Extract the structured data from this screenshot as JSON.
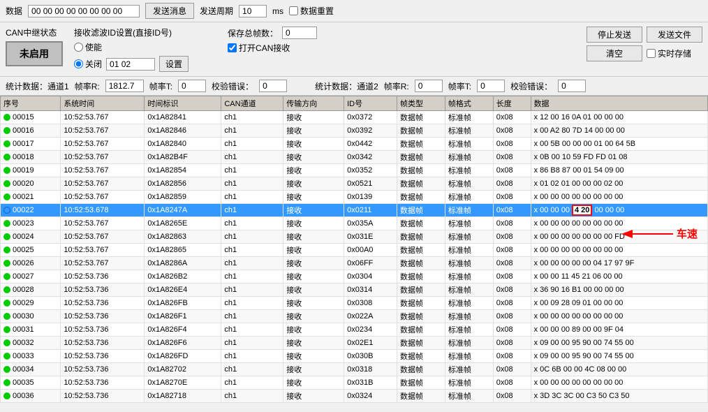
{
  "topbar": {
    "label_addr": "数据",
    "addr_value": "00 00 00 00 00 00 00 00",
    "send_msg_btn": "发送消息",
    "label_period": "发送周期",
    "period_value": "10",
    "period_unit": "ms",
    "label_loop": "数据重置"
  },
  "section1": {
    "can_status_label": "CAN中继状态",
    "can_status_value": "未启用",
    "filter_label": "接收滤波ID设置(直接ID号)",
    "enable_label": "使能",
    "close_label": "关闭",
    "filter_value": "01 02",
    "set_btn": "设置",
    "save_frames_label": "保存总帧数：",
    "save_frames_value": "0",
    "open_can_label": "打开CAN接收",
    "stop_send_btn": "停止发送",
    "send_file_btn": "发送文件",
    "clear_btn": "清空",
    "realtime_save_label": "实时存储"
  },
  "stats1": {
    "label": "统计数据：通道1",
    "frame_r_label": "帧率R:",
    "frame_r_value": "1812.7",
    "frame_t_label": "帧率T:",
    "frame_t_value": "0",
    "check_err_label": "校验错误：",
    "check_err_value": "0"
  },
  "stats2": {
    "label": "统计数据：通道2",
    "frame_r_label": "帧率R:",
    "frame_r_value": "0",
    "frame_t_label": "帧率T:",
    "frame_t_value": "0",
    "check_err_label": "校验错误：",
    "check_err_value": "0"
  },
  "table": {
    "headers": [
      "序号",
      "系统时间",
      "时间标识",
      "CAN通道",
      "传输方向",
      "ID号",
      "帧类型",
      "帧格式",
      "长度",
      "数据"
    ],
    "rows": [
      {
        "id": "00015",
        "time": "10:52:53.767",
        "ts": "0x1A82841",
        "ch": "ch1",
        "dir": "接收",
        "idno": "0x0372",
        "ftype": "数据帧",
        "fformat": "标准帧",
        "len": "0x08",
        "data": "x  12 00 16 0A 01 00 00 00",
        "selected": false,
        "highlight_cell": null
      },
      {
        "id": "00016",
        "time": "10:52:53.767",
        "ts": "0x1A82846",
        "ch": "ch1",
        "dir": "接收",
        "idno": "0x0392",
        "ftype": "数据帧",
        "fformat": "标准帧",
        "len": "0x08",
        "data": "x  00 A2 80 7D 14 00 00 00",
        "selected": false,
        "highlight_cell": null
      },
      {
        "id": "00017",
        "time": "10:52:53.767",
        "ts": "0x1A82840",
        "ch": "ch1",
        "dir": "接收",
        "idno": "0x0442",
        "ftype": "数据帧",
        "fformat": "标准帧",
        "len": "0x08",
        "data": "x  00 5B 00 00 00 01 00 64 5B",
        "selected": false,
        "highlight_cell": null
      },
      {
        "id": "00018",
        "time": "10:52:53.767",
        "ts": "0x1A82B4F",
        "ch": "ch1",
        "dir": "接收",
        "idno": "0x0342",
        "ftype": "数据帧",
        "fformat": "标准帧",
        "len": "0x08",
        "data": "x  0B 00 10 59 FD FD 01 08",
        "selected": false,
        "highlight_cell": null
      },
      {
        "id": "00019",
        "time": "10:52:53.767",
        "ts": "0x1A82854",
        "ch": "ch1",
        "dir": "接收",
        "idno": "0x0352",
        "ftype": "数据帧",
        "fformat": "标准帧",
        "len": "0x08",
        "data": "x  86 B8 87 00 01 54 09 00",
        "selected": false,
        "highlight_cell": null
      },
      {
        "id": "00020",
        "time": "10:52:53.767",
        "ts": "0x1A82856",
        "ch": "ch1",
        "dir": "接收",
        "idno": "0x0521",
        "ftype": "数据帧",
        "fformat": "标准帧",
        "len": "0x08",
        "data": "x  01 02 01 00 00 00 02 00",
        "selected": false,
        "highlight_cell": null
      },
      {
        "id": "00021",
        "time": "10:52:53.767",
        "ts": "0x1A82859",
        "ch": "ch1",
        "dir": "接收",
        "idno": "0x0139",
        "ftype": "数据帧",
        "fformat": "标准帧",
        "len": "0x08",
        "data": "x  00 00 00 00 00 00 00 00",
        "selected": false,
        "highlight_cell": null
      },
      {
        "id": "00022",
        "time": "10:52:53.678",
        "ts": "0x1A8247A",
        "ch": "ch1",
        "dir": "接收",
        "idno": "0x0211",
        "ftype": "数据帧",
        "fformat": "标准帧",
        "len": "0x08",
        "data": "x  00 00 00",
        "data_highlight": "4 20",
        "data_suffix": "00 00 00",
        "selected": true,
        "highlight_cell": "4 20"
      },
      {
        "id": "00023",
        "time": "10:52:53.767",
        "ts": "0x1A8265E",
        "ch": "ch1",
        "dir": "接收",
        "idno": "0x035A",
        "ftype": "数据帧",
        "fformat": "标准帧",
        "len": "0x08",
        "data": "x  00 00 00 00 00 00 00 00",
        "selected": false,
        "highlight_cell": null
      },
      {
        "id": "00024",
        "time": "10:52:53.767",
        "ts": "0x1A82863",
        "ch": "ch1",
        "dir": "接收",
        "idno": "0x031E",
        "ftype": "数据帧",
        "fformat": "标准帧",
        "len": "0x08",
        "data": "x  00 00 00 00 00 00 00 FD",
        "selected": false,
        "highlight_cell": null
      },
      {
        "id": "00025",
        "time": "10:52:53.767",
        "ts": "0x1A82865",
        "ch": "ch1",
        "dir": "接收",
        "idno": "0x00A0",
        "ftype": "数据帧",
        "fformat": "标准帧",
        "len": "0x08",
        "data": "x  00 00 00 00 00 00 00 00",
        "selected": false,
        "highlight_cell": null
      },
      {
        "id": "00026",
        "time": "10:52:53.767",
        "ts": "0x1A8286A",
        "ch": "ch1",
        "dir": "接收",
        "idno": "0x06FF",
        "ftype": "数据帧",
        "fformat": "标准帧",
        "len": "0x08",
        "data": "x  00 00 00 00 00 04 17 97 9F",
        "selected": false,
        "highlight_cell": null
      },
      {
        "id": "00027",
        "time": "10:52:53.736",
        "ts": "0x1A826B2",
        "ch": "ch1",
        "dir": "接收",
        "idno": "0x0304",
        "ftype": "数据帧",
        "fformat": "标准帧",
        "len": "0x08",
        "data": "x  00 00 11 45 21 06 00 00",
        "selected": false,
        "highlight_cell": null
      },
      {
        "id": "00028",
        "time": "10:52:53.736",
        "ts": "0x1A826E4",
        "ch": "ch1",
        "dir": "接收",
        "idno": "0x0314",
        "ftype": "数据帧",
        "fformat": "标准帧",
        "len": "0x08",
        "data": "x  36 90 16 B1 00 00 00 00",
        "selected": false,
        "highlight_cell": null
      },
      {
        "id": "00029",
        "time": "10:52:53.736",
        "ts": "0x1A826FB",
        "ch": "ch1",
        "dir": "接收",
        "idno": "0x0308",
        "ftype": "数据帧",
        "fformat": "标准帧",
        "len": "0x08",
        "data": "x  00 09 28 09 01 00 00 00",
        "selected": false,
        "highlight_cell": null
      },
      {
        "id": "00030",
        "time": "10:52:53.736",
        "ts": "0x1A826F1",
        "ch": "ch1",
        "dir": "接收",
        "idno": "0x022A",
        "ftype": "数据帧",
        "fformat": "标准帧",
        "len": "0x08",
        "data": "x  00 00 00 00 00 00 00 00",
        "selected": false,
        "highlight_cell": null
      },
      {
        "id": "00031",
        "time": "10:52:53.736",
        "ts": "0x1A826F4",
        "ch": "ch1",
        "dir": "接收",
        "idno": "0x0234",
        "ftype": "数据帧",
        "fformat": "标准帧",
        "len": "0x08",
        "data": "x  00 00 00 89 00 00 9F 04",
        "selected": false,
        "highlight_cell": null
      },
      {
        "id": "00032",
        "time": "10:52:53.736",
        "ts": "0x1A826F6",
        "ch": "ch1",
        "dir": "接收",
        "idno": "0x02E1",
        "ftype": "数据帧",
        "fformat": "标准帧",
        "len": "0x08",
        "data": "x  09 00 00 95 90 00 74 55 00",
        "selected": false,
        "highlight_cell": null
      },
      {
        "id": "00033",
        "time": "10:52:53.736",
        "ts": "0x1A826FD",
        "ch": "ch1",
        "dir": "接收",
        "idno": "0x030B",
        "ftype": "数据帧",
        "fformat": "标准帧",
        "len": "0x08",
        "data": "x  09 00 00 95 90 00 74 55 00",
        "selected": false,
        "highlight_cell": null
      },
      {
        "id": "00034",
        "time": "10:52:53.736",
        "ts": "0x1A82702",
        "ch": "ch1",
        "dir": "接收",
        "idno": "0x0318",
        "ftype": "数据帧",
        "fformat": "标准帧",
        "len": "0x08",
        "data": "x  0C 6B 00 00 4C 08 00 00",
        "selected": false,
        "highlight_cell": null
      },
      {
        "id": "00035",
        "time": "10:52:53.736",
        "ts": "0x1A8270E",
        "ch": "ch1",
        "dir": "接收",
        "idno": "0x031B",
        "ftype": "数据帧",
        "fformat": "标准帧",
        "len": "0x08",
        "data": "x  00 00 00 00 00 00 00 00",
        "selected": false,
        "highlight_cell": null
      },
      {
        "id": "00036",
        "time": "10:52:53.736",
        "ts": "0x1A82718",
        "ch": "ch1",
        "dir": "接收",
        "idno": "0x0324",
        "ftype": "数据帧",
        "fformat": "标准帧",
        "len": "0x08",
        "data": "x  3D 3C 3C 00 C3 50 C3 50",
        "selected": false,
        "highlight_cell": null
      }
    ]
  },
  "car_speed_label": "车速"
}
